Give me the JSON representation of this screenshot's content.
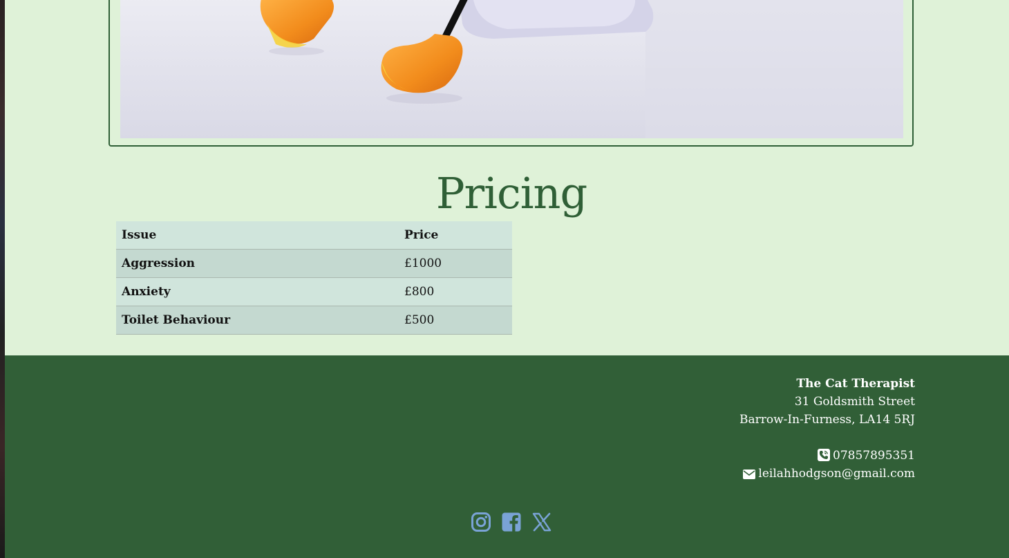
{
  "pricing": {
    "title": "Pricing",
    "table": {
      "headers": [
        "Issue",
        "Price"
      ],
      "rows": [
        {
          "issue": "Aggression",
          "price": "£1000"
        },
        {
          "issue": "Anxiety",
          "price": "£800"
        },
        {
          "issue": "Toilet Behaviour",
          "price": "£500"
        }
      ]
    }
  },
  "footer": {
    "business_name": "The Cat Therapist",
    "address_line1": "31 Goldsmith Street",
    "address_line2": "Barrow-In-Furness, LA14 5RJ",
    "phone": "07857895351",
    "email": "leilahhodgson@gmail.com",
    "social_icons": [
      "instagram-icon",
      "facebook-icon",
      "x-twitter-icon"
    ]
  },
  "colors": {
    "page_background": "#dff2d8",
    "accent_green": "#315f37",
    "table_row_light": "#d0e5dc",
    "table_row_dark": "#c4d9d0",
    "social_icon": "#7aa3d6"
  }
}
